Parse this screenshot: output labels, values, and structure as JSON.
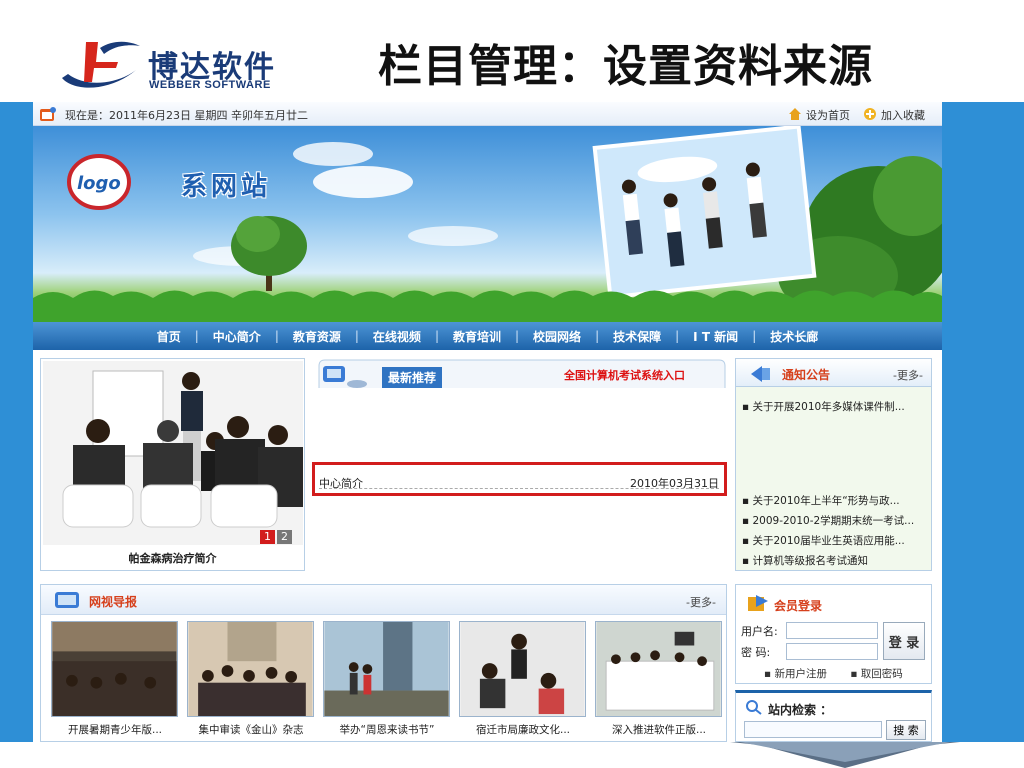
{
  "slide": {
    "title": "栏目管理：设置资料来源",
    "brand_cn": "博达软件",
    "brand_en": "WEBBER SOFTWARE"
  },
  "topbar": {
    "date_text": "现在是：2011年6月23日  星期四  辛卯年五月廿二",
    "set_home": "设为首页",
    "add_fav": "加入收藏"
  },
  "banner": {
    "logo_text": "logo",
    "site_name": "系网站"
  },
  "nav": {
    "items": [
      "首页",
      "中心简介",
      "教育资源",
      "在线视频",
      "教育培训",
      "校园网络",
      "技术保障",
      "I T 新闻",
      "技术长廊"
    ]
  },
  "slideshow": {
    "caption": "帕金森病治疗简介",
    "pages": [
      "1",
      "2"
    ],
    "active_page": "1"
  },
  "recommend": {
    "title": "最新推荐",
    "link": "全国计算机考试系统入口",
    "items": [
      {
        "title": "中心简介",
        "date": "2010年03月31日"
      }
    ]
  },
  "notice": {
    "title": "通知公告",
    "more": "-更多-",
    "items": [
      "关于开展2010年多媒体课件制...",
      "关于2010年上半年“形势与政...",
      "2009-2010-2学期期末统一考试...",
      "关于2010届毕业生英语应用能...",
      "计算机等级报名考试通知"
    ]
  },
  "video": {
    "title": "网视导报",
    "more": "-更多-",
    "items": [
      "开展暑期青少年版...",
      "集中审读《金山》杂志",
      "举办“周恩来读书节”",
      "宿迁市局廉政文化...",
      "深入推进软件正版..."
    ]
  },
  "login": {
    "title": "会员登录",
    "username_label": "用户名:",
    "password_label": "密  码:",
    "button": "登 录",
    "register": "新用户注册",
    "recover": "取回密码"
  },
  "search": {
    "title": "站内检索 ：",
    "button": "搜 索"
  },
  "colors": {
    "band_blue": "#2e8fd6",
    "nav_blue": "#1d63a9",
    "highlight_red": "#d21c1c",
    "panel_title_orange": "#d6401c"
  }
}
